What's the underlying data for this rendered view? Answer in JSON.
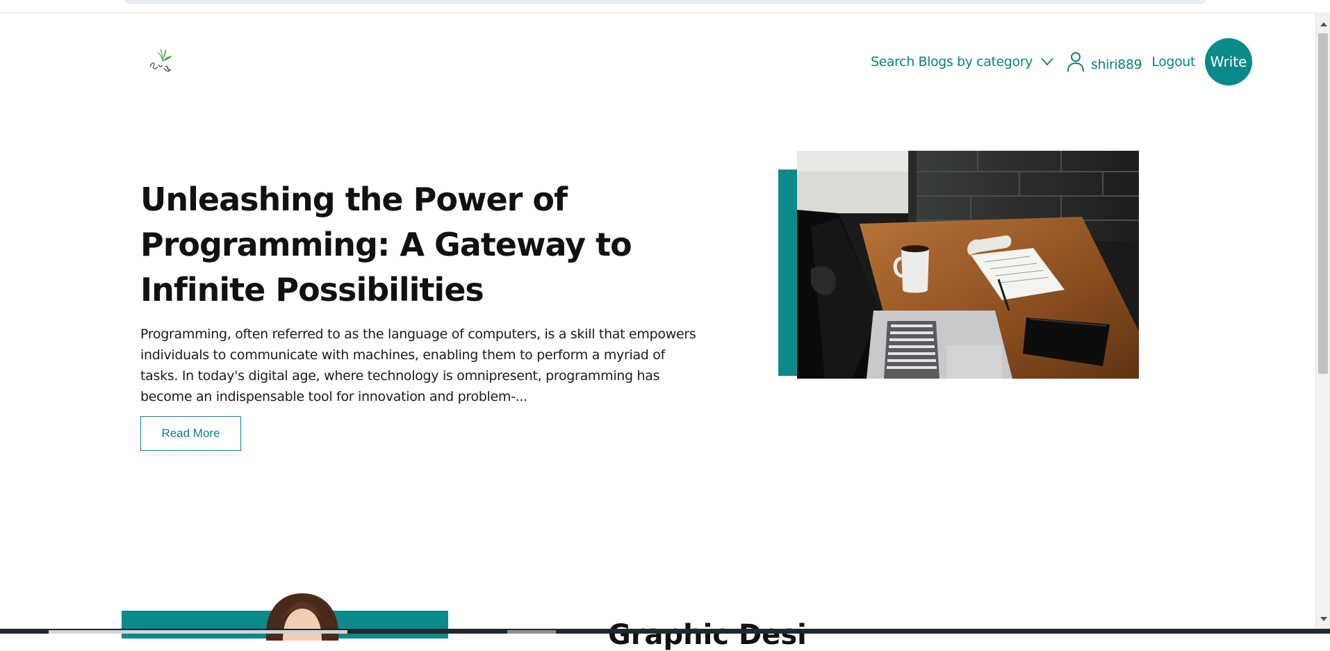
{
  "nav": {
    "category_label": "Search Blogs by category",
    "username": "shiri889",
    "logout": "Logout",
    "write": "Write"
  },
  "hero": {
    "title": "Unleashing the Power of Programming: A Gateway to Infinite Possibilities",
    "excerpt": "Programming, often referred to as the language of computers, is a skill that empowers individuals to communicate with machines, enabling them to perform a myriad of tasks. In today's digital age, where technology is omnipresent, programming has become an indispensable tool for innovation and problem-...",
    "read_more": "Read More"
  },
  "second_post": {
    "title_partial": "Graphic Desi"
  },
  "colors": {
    "accent": "#0a8a8a",
    "link": "#0e7f7f"
  },
  "icons": {
    "chevron": "chevron-down-icon",
    "user": "user-icon",
    "logo": "leaf-logo"
  }
}
